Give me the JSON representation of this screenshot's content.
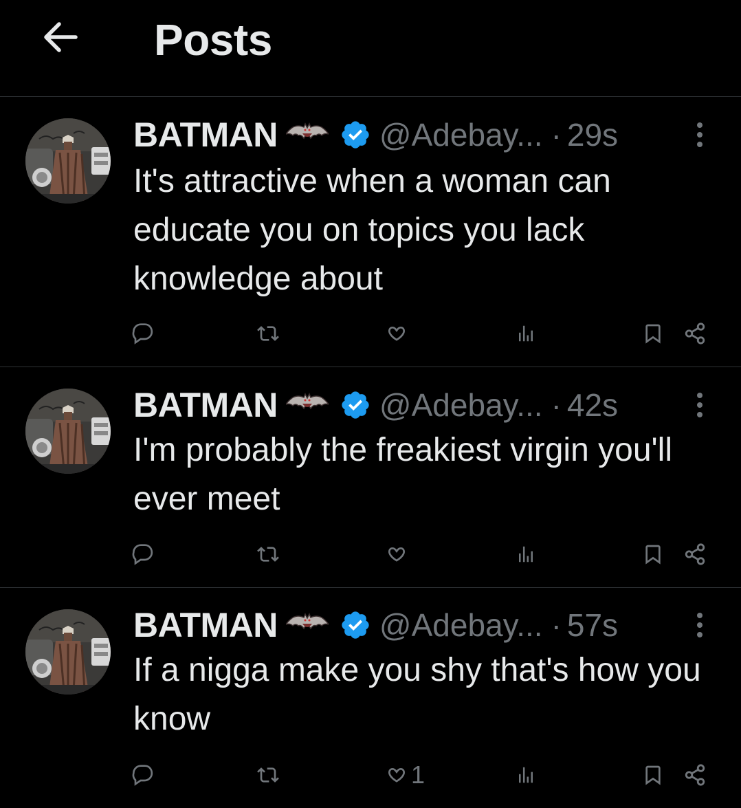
{
  "header": {
    "title": "Posts",
    "back_icon": "arrow-left-icon"
  },
  "colors": {
    "background": "#000000",
    "text": "#e7e9ea",
    "muted": "#71767b",
    "divider": "#2f3336",
    "verified": "#1d9bf0"
  },
  "posts": [
    {
      "display_name": "BATMAN",
      "name_emoji": "bat-emoji",
      "verified": true,
      "handle": "@Adebay...",
      "separator": "·",
      "time": "29s",
      "text": "It's attractive when a woman can educate you on topics you lack knowledge about",
      "likes": ""
    },
    {
      "display_name": "BATMAN",
      "name_emoji": "bat-emoji",
      "verified": true,
      "handle": "@Adebay...",
      "separator": "·",
      "time": "42s",
      "text": "I'm probably the freakiest virgin you'll ever meet",
      "likes": ""
    },
    {
      "display_name": "BATMAN",
      "name_emoji": "bat-emoji",
      "verified": true,
      "handle": "@Adebay...",
      "separator": "·",
      "time": "57s",
      "text": "If a nigga make you shy that's how you know",
      "likes": "1"
    }
  ]
}
